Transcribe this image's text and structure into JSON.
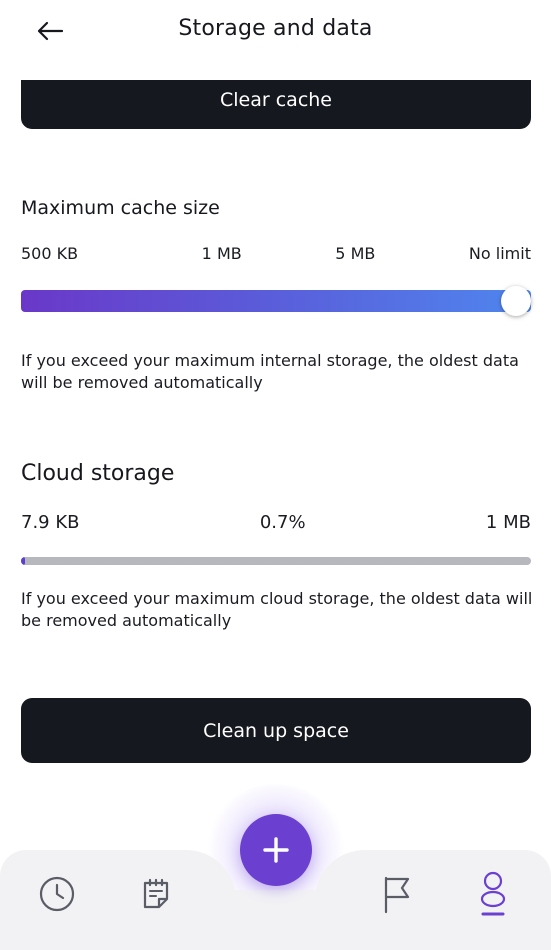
{
  "header": {
    "title": "Storage and data"
  },
  "cache": {
    "clear_button": "Clear cache",
    "title": "Maximum cache size",
    "ticks": [
      "500 KB",
      "1 MB",
      "5 MB",
      "No limit"
    ],
    "slider_value_fraction": 1.0,
    "selected": "No limit",
    "description": "If you exceed your maximum internal storage, the oldest data will be removed automatically"
  },
  "cloud": {
    "title": "Cloud storage",
    "used": "7.9 KB",
    "percent": "0.7%",
    "limit": "1 MB",
    "progress_fraction": 0.007,
    "description": "If you exceed your maximum cloud storage, the oldest data will be removed automatically"
  },
  "actions": {
    "cleanup_button": "Clean up space"
  },
  "nav": {
    "items": [
      {
        "icon": "clock-icon"
      },
      {
        "icon": "notes-icon"
      },
      {
        "icon": "plus-icon"
      },
      {
        "icon": "flag-icon"
      },
      {
        "icon": "profile-icon"
      }
    ],
    "active_index": 4
  },
  "colors": {
    "accent": "#6b3fd0",
    "dark_button": "#15181f",
    "slider_start": "#6a38c9",
    "slider_end": "#4f86ee",
    "track_gray": "#b7b8bd",
    "nav_bg": "#f2f2f5"
  }
}
